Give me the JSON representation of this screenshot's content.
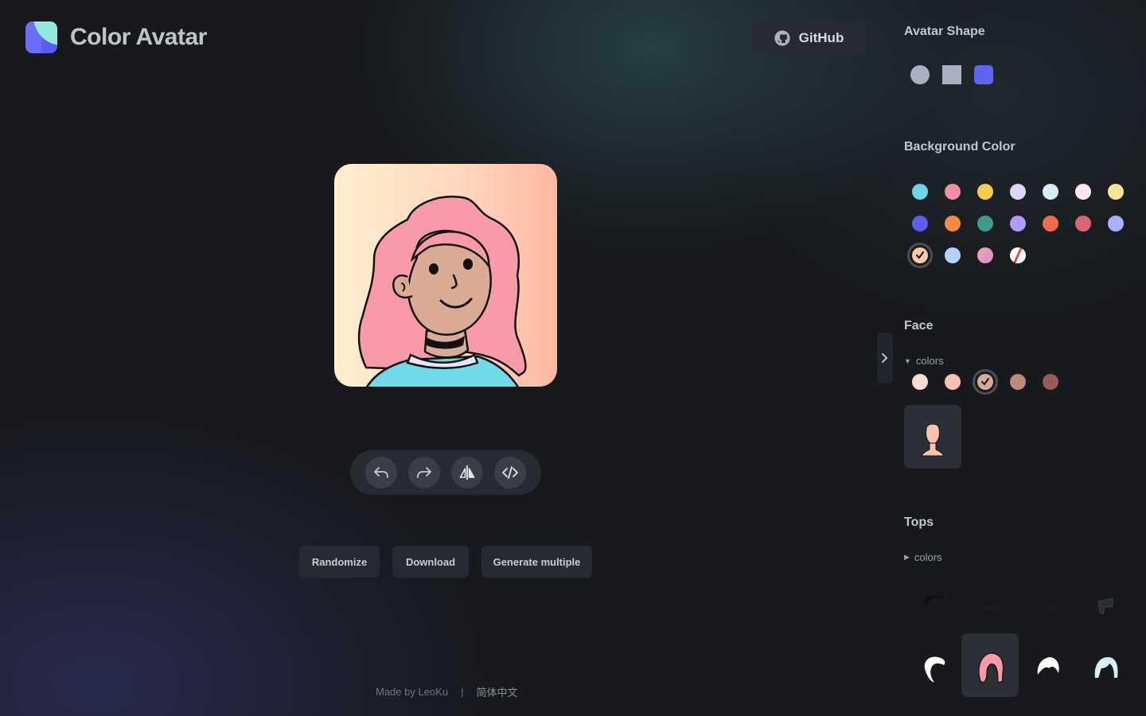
{
  "header": {
    "app_title": "Color Avatar",
    "github_label": "GitHub"
  },
  "avatar": {
    "background_gradient": [
      "#ffeed0",
      "#ffd9c0",
      "#fcb8a0"
    ],
    "hair_color": "#f99aa9",
    "skin_color": "#d9ab94",
    "shirt_color": "#6fdbe8",
    "collar_color": "#e7e5f7"
  },
  "actions": {
    "undo_icon": "undo-icon",
    "redo_icon": "redo-icon",
    "flip_icon": "flip-icon",
    "code_icon": "code-icon"
  },
  "buttons": {
    "randomize": "Randomize",
    "download": "Download",
    "generate_multiple": "Generate multiple"
  },
  "footer": {
    "made_by": "Made by LeoKu",
    "separator": "|",
    "language": "简体中文"
  },
  "panel": {
    "avatar_shape": {
      "title": "Avatar Shape",
      "options": [
        {
          "name": "circle",
          "color": "#a9b1c0"
        },
        {
          "name": "square",
          "color": "#a9b1c0"
        },
        {
          "name": "squircle",
          "color": "#6064f4",
          "selected": true
        }
      ]
    },
    "background_color": {
      "title": "Background Color",
      "swatches": [
        "#6bd5e6",
        "#f38fa0",
        "#f3cd4b",
        "#ded7fa",
        "#d6eff2",
        "#fbe7ec",
        "#fbe39a",
        "#5b5ef0",
        "#f58a47",
        "#3e9c8c",
        "#b59afa",
        "#f16a4e",
        "#dc6670",
        "#a9b3fb",
        "#f8c8a8",
        "#b3d4fb",
        "#e497c0",
        "#ffffff"
      ],
      "selected_index": 14
    },
    "face": {
      "title": "Face",
      "colors_label": "colors",
      "colors": [
        "#fbdcd0",
        "#f7c3ad",
        "#d9ab94",
        "#c08b76",
        "#9a5c50"
      ],
      "selected_index": 2
    },
    "tops": {
      "title": "Tops",
      "colors_label": "colors"
    }
  }
}
